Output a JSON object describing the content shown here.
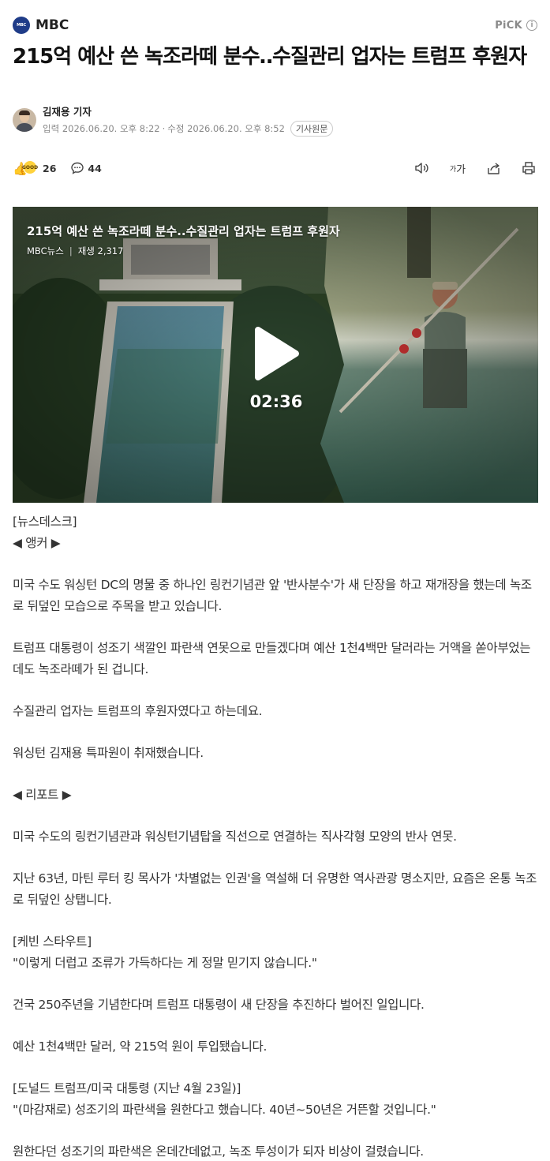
{
  "press": {
    "logo_text": "MBC",
    "name": "MBC",
    "pick_label": "PiCK",
    "info_icon": "info-icon"
  },
  "headline": "215억 예산 쓴 녹조라떼 분수‥수질관리 업자는 트럼프 후원자",
  "byline": {
    "reporter": "김재용 기자",
    "published": "입력 2026.06.20. 오후 8:22",
    "separator": "·",
    "modified": "수정 2026.06.20. 오후 8:52",
    "original_button": "기사원문"
  },
  "reactions": {
    "count": "26",
    "comments": "44",
    "emoji_badge": "GOOD"
  },
  "tools": [
    "speaker-icon",
    "font-size-icon",
    "share-icon",
    "print-icon"
  ],
  "font_tool": {
    "small": "가",
    "large": "가"
  },
  "video": {
    "title": "215억 예산 쓴 녹조라떼 분수..수질관리 업자는 트럼프 후원자",
    "channel": "MBC뉴스",
    "views": "재생 2,317",
    "duration": "02:36"
  },
  "article": {
    "p1": "[뉴스데스크]",
    "p2": "◀ 앵커 ▶",
    "p3": "미국 수도 워싱턴 DC의 명물 중 하나인 링컨기념관 앞 '반사분수'가 새 단장을 하고 재개장을 했는데 녹조로 뒤덮인 모습으로 주목을 받고 있습니다.",
    "p4": "트럼프 대통령이 성조기 색깔인 파란색 연못으로 만들겠다며 예산 1천4백만 달러라는 거액을 쏟아부었는데도 녹조라떼가 된 겁니다.",
    "p5": "수질관리 업자는 트럼프의 후원자였다고 하는데요.",
    "p6": "워싱턴 김재용 특파원이 취재했습니다.",
    "p7": "◀ 리포트 ▶",
    "p8": "미국 수도의 링컨기념관과 워싱턴기념탑을 직선으로 연결하는 직사각형 모양의 반사 연못.",
    "p9": "지난 63년, 마틴 루터 킹 목사가 '차별없는 인권'을 역설해 더 유명한 역사관광 명소지만, 요즘은 온통 녹조로 뒤덮인 상탭니다.",
    "p10": "[케빈 스타우트]",
    "p11": "\"이렇게 더럽고 조류가 가득하다는 게 정말 믿기지 않습니다.\"",
    "p12": "건국 250주년을 기념한다며 트럼프 대통령이 새 단장을 추진하다 벌어진 일입니다.",
    "p13": "예산 1천4백만 달러, 약 215억 원이 투입됐습니다.",
    "p14": "[도널드 트럼프/미국 대통령 (지난 4월 23일)]",
    "p15": "\"(마감재로) 성조기의 파란색을 원한다고 했습니다. 40년~50년은 거뜬할 것입니다.\"",
    "p16": "원한다던 성조기의 파란색은 온데간데없고, 녹조 투성이가 되자 비상이 걸렸습니다."
  },
  "colors": {
    "logo_bg": "#1f3c88",
    "emoji_yellow": "#ffd23c",
    "water_green": "#3e6e6a"
  }
}
